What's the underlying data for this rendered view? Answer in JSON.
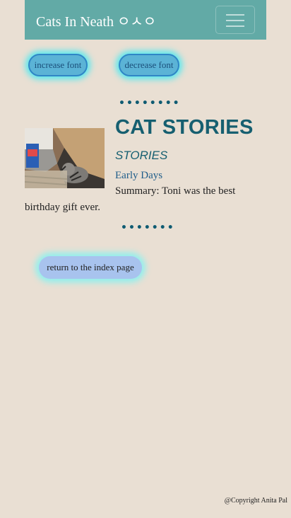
{
  "navbar": {
    "brand": "Cats In Neath ㅇㅅㅇ",
    "toggler_icon": "hamburger-menu-icon"
  },
  "font_controls": {
    "increase_label": "increase font",
    "decrease_label": "decrease font"
  },
  "divider_top": "••••••••",
  "divider_bottom": "•••••••",
  "story": {
    "image_alt": "Tabby cat lying inside a cardboard box",
    "title": "CAT STORIES",
    "subtitle": "STORIES",
    "link_label": "Early Days",
    "summary_line1": "Summary: Toni was the best",
    "summary_line2": "birthday gift ever."
  },
  "return_label": "return to the index page",
  "footer": {
    "copyright": "@Copyright Anita Pal"
  },
  "colors": {
    "navbar": "#62aaa6",
    "background": "#e9dfd3",
    "title": "#165f70",
    "glow": "#55e8ef"
  }
}
